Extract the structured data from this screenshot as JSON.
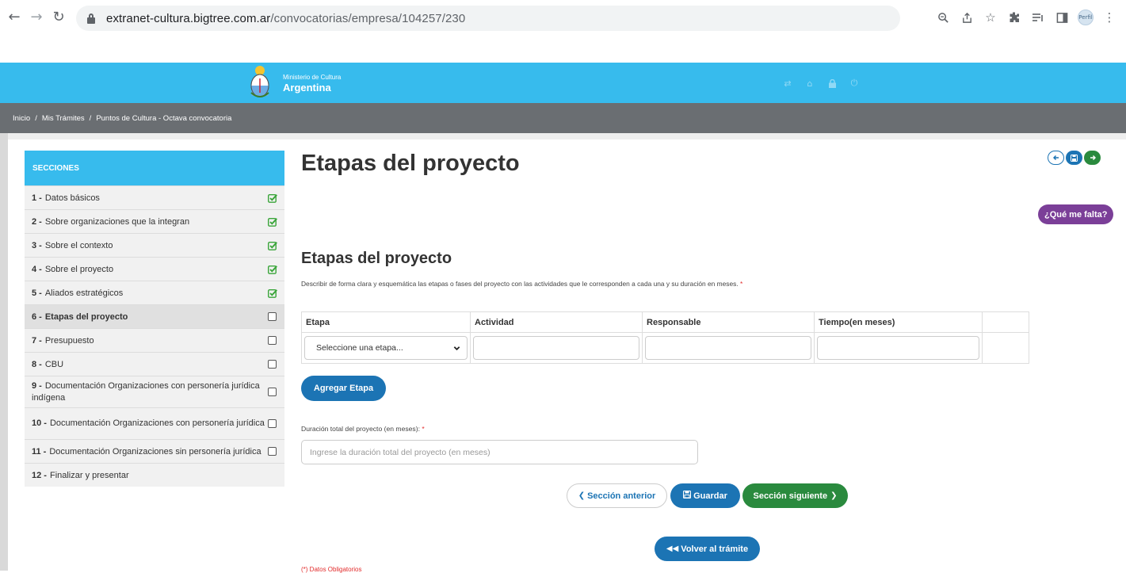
{
  "browser": {
    "url_host": "extranet-cultura.bigtree.com.ar",
    "url_path": "/convocatorias/empresa/104257/230",
    "profile_label": "Perfil"
  },
  "header": {
    "ministry_small": "Ministerio de Cultura",
    "ministry_big": "Argentina",
    "icons": [
      "switch-icon",
      "home-icon",
      "lock-icon",
      "power-icon"
    ]
  },
  "breadcrumb": {
    "items": [
      "Inicio",
      "Mis Trámites",
      "Puntos de Cultura - Octava convocatoria"
    ]
  },
  "sidebar": {
    "title": "SECCIONES",
    "items": [
      {
        "num": "1 -",
        "label": "Datos básicos",
        "status": "complete"
      },
      {
        "num": "2 -",
        "label": "Sobre organizaciones que la integran",
        "status": "complete"
      },
      {
        "num": "3 -",
        "label": "Sobre el contexto",
        "status": "complete"
      },
      {
        "num": "4 -",
        "label": "Sobre el proyecto",
        "status": "complete"
      },
      {
        "num": "5 -",
        "label": "Aliados estratégicos",
        "status": "complete"
      },
      {
        "num": "6 -",
        "label": "Etapas del proyecto",
        "status": "pending",
        "active": true
      },
      {
        "num": "7 -",
        "label": "Presupuesto",
        "status": "pending"
      },
      {
        "num": "8 -",
        "label": "CBU",
        "status": "pending"
      },
      {
        "num": "9 -",
        "label": "Documentación Organizaciones con personería jurídica indígena",
        "status": "pending"
      },
      {
        "num": "10 -",
        "label": "Documentación Organizaciones con personería jurídica",
        "status": "pending"
      },
      {
        "num": "11 -",
        "label": "Documentación Organizaciones sin personería jurídica",
        "status": "pending"
      },
      {
        "num": "12 -",
        "label": "Finalizar y presentar",
        "status": "none"
      }
    ]
  },
  "main": {
    "title": "Etapas del proyecto",
    "que_falta": "¿Qué me falta?",
    "section_title": "Etapas del proyecto",
    "description": "Describir de forma clara y esquemática las etapas o fases del proyecto con las actividades que le corresponden a cada una y su duración en meses.",
    "required_mark": "*",
    "table": {
      "headers": [
        "Etapa",
        "Actividad",
        "Responsable",
        "Tiempo(en meses)",
        ""
      ],
      "select_value": "Seleccione una etapa..."
    },
    "add_button": "Agregar Etapa",
    "duration_label": "Duración total del proyecto (en meses):",
    "duration_placeholder": "Ingrese la duración total del proyecto (en meses)",
    "buttons": {
      "prev": "Sección anterior",
      "save": "Guardar",
      "next": "Sección siguiente",
      "back": "Volver al trámite"
    },
    "footnote": "(*) Datos Obligatorios"
  },
  "colors": {
    "header_blue": "#37bbed",
    "breadcrumb_gray": "#6a6e72",
    "primary_blue": "#1c74b4",
    "success_green": "#2a8a3e",
    "purple": "#7b3f98",
    "check_green": "#3aa53a",
    "required_red": "#e22b2b"
  }
}
